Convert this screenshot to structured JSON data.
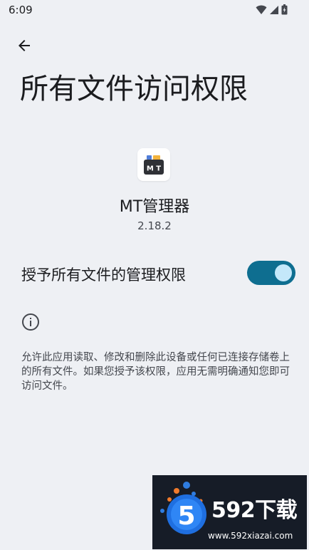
{
  "status_bar": {
    "time": "6:09",
    "icons": [
      "wifi-icon",
      "cellular-signal-icon",
      "battery-icon"
    ]
  },
  "navigation": {
    "back_icon": "arrow-back-icon"
  },
  "page": {
    "title": "所有文件访问权限"
  },
  "app": {
    "icon_text": "M T",
    "name": "MT管理器",
    "version": "2.18.2"
  },
  "permission": {
    "label": "授予所有文件的管理权限",
    "enabled": true
  },
  "info": {
    "icon": "info-icon",
    "description": "允许此应用读取、修改和删除此设备或任何已连接存储卷上的所有文件。如果您授予该权限，应用无需明确通知您即可访问文件。"
  },
  "watermark": {
    "logo_digit": "5",
    "brand": "592下载",
    "url": "www.592xiazai.com"
  },
  "colors": {
    "background": "#EEF0F4",
    "toggle_track": "#0E6E90",
    "toggle_knob": "#C4E8FA",
    "text_primary": "#1B1C1F",
    "text_secondary": "#44474E"
  }
}
